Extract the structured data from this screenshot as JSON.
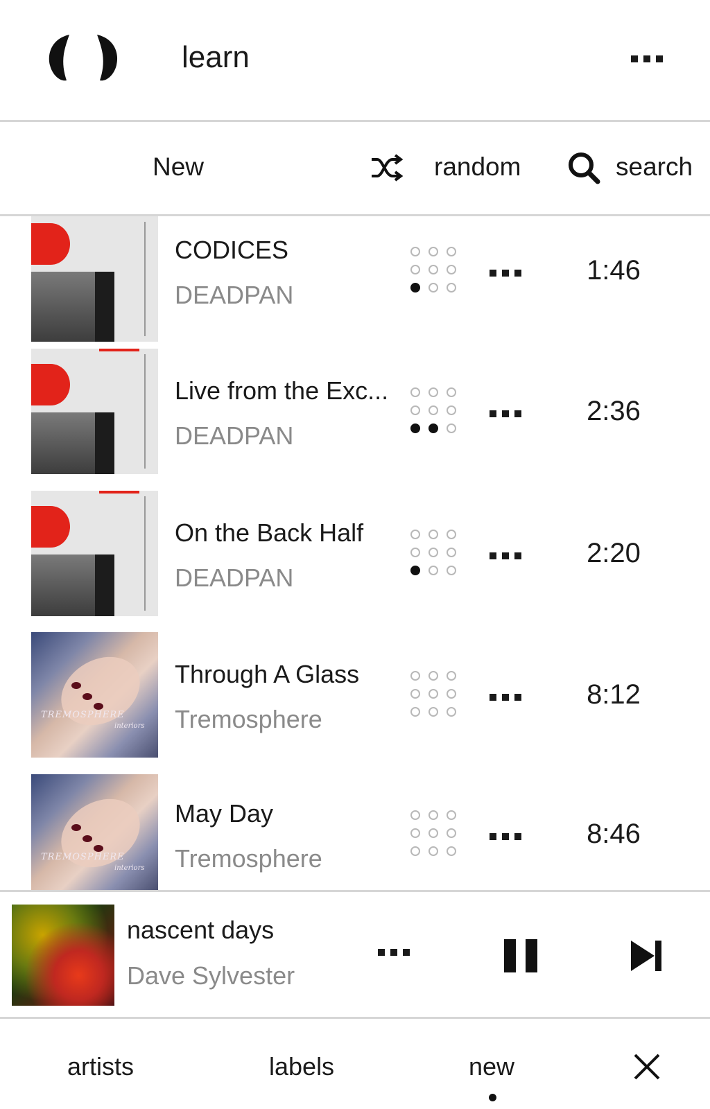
{
  "header": {
    "title": "learn",
    "logo_icon": "pill-logo-icon",
    "more_icon": "more-horizontal-icon"
  },
  "toolbar": {
    "new_label": "New",
    "random_label": "random",
    "search_label": "search",
    "shuffle_icon": "shuffle-icon",
    "search_icon": "search-icon"
  },
  "tracks": [
    {
      "title": "CODICES",
      "artist": "DEADPAN",
      "duration": "1:46",
      "rating": 1
    },
    {
      "title": "Live from the Exc...",
      "artist": "DEADPAN",
      "duration": "2:36",
      "rating": 2
    },
    {
      "title": "On the Back Half",
      "artist": "DEADPAN",
      "duration": "2:20",
      "rating": 1
    },
    {
      "title": "Through A Glass",
      "artist": "Tremosphere",
      "duration": "8:12",
      "rating": 0
    },
    {
      "title": "May Day",
      "artist": "Tremosphere",
      "duration": "8:46",
      "rating": 0
    }
  ],
  "covers": {
    "tremosphere_brand": "TREMOSPHERE",
    "tremosphere_sub": "interiors"
  },
  "now_playing": {
    "title": "nascent days",
    "artist": "Dave Sylvester",
    "pause_icon": "pause-icon",
    "next_icon": "skip-next-icon"
  },
  "nav": {
    "artists": "artists",
    "labels": "labels",
    "new": "new",
    "active": "new",
    "close_icon": "close-icon"
  },
  "colors": {
    "accent_red": "#e2231a",
    "text": "#1a1a1a",
    "muted": "#8a8a8a",
    "divider": "#d6d6d6"
  }
}
